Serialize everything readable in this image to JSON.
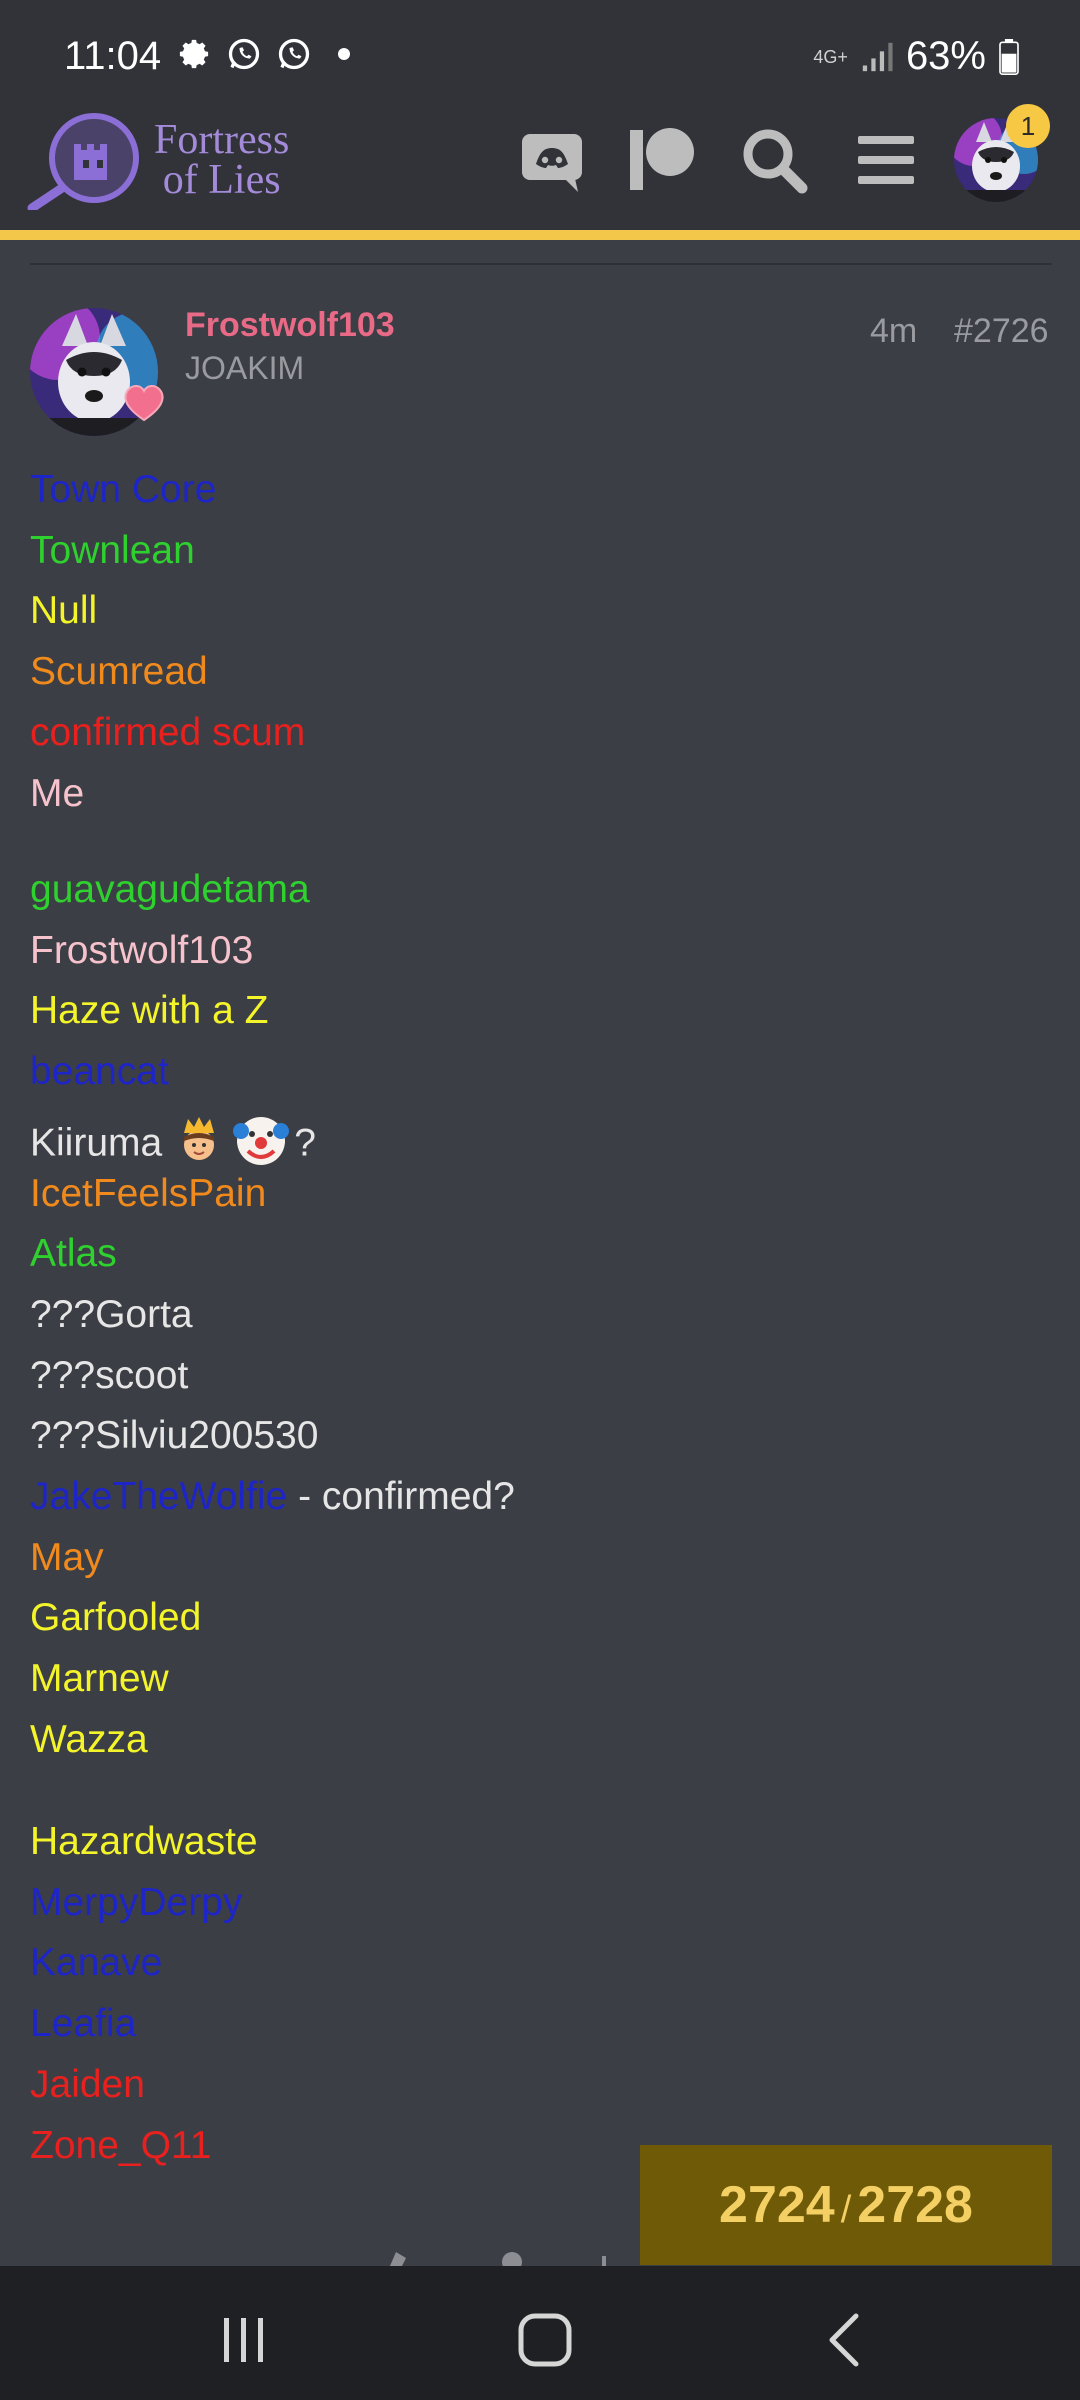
{
  "status": {
    "time": "11:04",
    "network": "4G+",
    "battery": "63%"
  },
  "header": {
    "logo_line1": "Fortress",
    "logo_line2": "of Lies",
    "notification_count": "1",
    "icons": [
      "discord-icon",
      "patreon-icon",
      "search-icon",
      "menu-icon"
    ]
  },
  "post": {
    "username": "Frostwolf103",
    "user_title": "JOAKIM",
    "time_ago": "4m",
    "post_number": "#2726",
    "legend": [
      {
        "text": "Town Core",
        "color": "#1d24c8"
      },
      {
        "text": "Townlean",
        "color": "#2fd12f"
      },
      {
        "text": "Null",
        "color": "#f4f42a"
      },
      {
        "text": "Scumread",
        "color": "#f08a1c"
      },
      {
        "text": "confirmed scum",
        "color": "#e8201e"
      },
      {
        "text": "Me",
        "color": "#f6c2cc"
      }
    ],
    "players_group1": [
      {
        "text": "guavagudetama",
        "color": "#2fd12f"
      },
      {
        "text": "Frostwolf103",
        "color": "#f6c2cc"
      },
      {
        "text": "Haze with a Z",
        "color": "#f4f42a"
      },
      {
        "text": "beancat",
        "color": "#1d24c8"
      },
      {
        "text": "Kiiruma",
        "color": "#e6e6e6",
        "suffix": "?"
      },
      {
        "text": "IcetFeelsPain",
        "color": "#f08a1c"
      },
      {
        "text": "Atlas",
        "color": "#2fd12f"
      },
      {
        "text": "???Gorta",
        "color": "#e6e6e6"
      },
      {
        "text": "???scoot",
        "color": "#e6e6e6"
      },
      {
        "text": "???Silviu200530",
        "color": "#e6e6e6"
      },
      {
        "text": "JakeTheWolfie",
        "color": "#1d24c8",
        "suffix": " - confirmed?"
      },
      {
        "text": "May",
        "color": "#f08a1c"
      },
      {
        "text": "Garfooled",
        "color": "#f4f42a"
      },
      {
        "text": "Marnew",
        "color": "#f4f42a"
      },
      {
        "text": "Wazza",
        "color": "#f4f42a"
      }
    ],
    "players_group2": [
      {
        "text": "Hazardwaste",
        "color": "#f4f42a"
      },
      {
        "text": "MerpyDerpy",
        "color": "#1d24c8"
      },
      {
        "text": "Kanave",
        "color": "#1d24c8"
      },
      {
        "text": "Leafia",
        "color": "#1d24c8"
      },
      {
        "text": "Jaiden",
        "color": "#e8201e"
      },
      {
        "text": "Zone_Q11",
        "color": "#e8201e"
      }
    ]
  },
  "progress": {
    "current": "2724",
    "separator": "/",
    "total": "2728"
  },
  "colors": {
    "background": "#3c3e45",
    "header": "#313338",
    "accent": "#f3c74a",
    "progress_bg": "#6e5a07"
  }
}
